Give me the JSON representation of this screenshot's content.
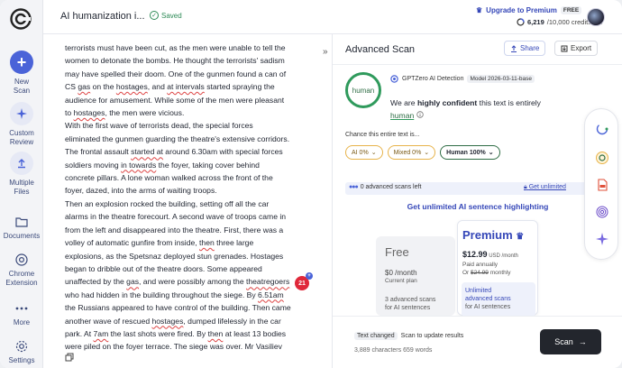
{
  "app": {
    "document_title": "AI humanization i...",
    "saved_label": "Saved",
    "upgrade_label": "Upgrade to Premium",
    "plan_badge": "FREE",
    "credits_used": "6,219",
    "credits_total": "/10,000 credits left"
  },
  "rail": {
    "new_scan": "New\nScan",
    "custom_review": "Custom\nReview",
    "multiple_files": "Multiple\nFiles",
    "documents": "Documents",
    "chrome_extension": "Chrome\nExtension",
    "more": "More",
    "settings": "Settings"
  },
  "document": {
    "text": "terrorists must have been cut, as the men were unable to tell the\nwomen to detonate the bombs. He thought the terrorists' sadism\nmay have spelled their doom. One of the gunmen found a can of\nCS gas on the hostages, and at intervals started spraying the\naudience for amusement. While some of the men were pleasant\nto hostages, the men were vicious.\nWith the first wave of terrorists dead, the special forces\neliminated the gunmen guarding the theatre's extensive corridors.\nThe frontal assault started at around 6.30am with special forces\nsoldiers moving in towards the foyer, taking cover behind\nconcrete pillars. A lone woman walked across the front of the\nfoyer, dazed, into the arms of waiting troops.\nThen an explosion rocked the building, setting off all the car\nalarms in the theatre forecourt. A second wave of troops came in\nfrom the left and disappeared into the theatre. First, there was a\nvolley of automatic gunfire from inside, then three large\nexplosions, as the Spetsnaz deployed stun grenades. Hostages\nbegan to dribble out of the theatre doors. Some appeared\nunaffected by the gas, and were possibly among the theatregoers\nwho had hidden in the building throughout the siege. By 6.51am\nthe Russians appeared to have control of the building. Then came\nanother wave of rescued hostages, dumped lifelessly in the car\npark. At 7am the last shots were fired. By then at least 13 bodies\nwere piled on the foyer terrace. The siege was over. Mr Vasiliev",
    "grammar_count": "21"
  },
  "panel": {
    "title": "Advanced Scan",
    "share_label": "Share",
    "export_label": "Export",
    "result_label": "human",
    "detector_name": "GPTZero AI Detection",
    "model_badge": "Model 2026-03-11-base",
    "verdict_prefix": "We are ",
    "verdict_confidence": "highly confident",
    "verdict_middle": " this text is entirely",
    "verdict_result": "human",
    "chance_label": "Chance this entire text is...",
    "pill_ai": "AI 0%",
    "pill_mixed": "Mixed 0%",
    "pill_human": "Human 100%",
    "scans_left": "0 advanced scans left",
    "get_unlimited": "Get unlimited",
    "upsell_title": "Get unlimited AI sentence highlighting",
    "free_plan": {
      "name": "Free",
      "price": "$0 /month",
      "sub": "Current plan",
      "feature": "3 advanced scans\nfor AI sentences"
    },
    "premium_plan": {
      "name": "Premium",
      "price": "$12.99",
      "price_unit": " USD /month",
      "billed": "Paid annually",
      "billed_alt_prefix": "Or ",
      "billed_alt_price": "$24.99",
      "billed_alt_suffix": " monthly",
      "feature_highlight": "Unlimited\nadvanced scans",
      "feature_rest": "for AI sentences"
    },
    "text_changed": "Text changed",
    "scan_to_update": "Scan to update results",
    "counts": "3,889 characters  659 words",
    "scan_button": "Scan"
  },
  "colors": {
    "brand": "#3547b8",
    "human_green": "#2f9a5c",
    "warning_amber": "#e7b34a",
    "grammar_red": "#e0283a"
  },
  "icons": [
    "gptzero-logo-icon",
    "plus-icon",
    "sparkle-icon",
    "upload-icon",
    "folder-icon",
    "chrome-icon",
    "more-icon",
    "gear-icon",
    "check-circle-icon",
    "crown-icon",
    "share-icon",
    "export-icon",
    "info-icon",
    "lock-icon",
    "arrow-right-icon",
    "copy-icon",
    "collapse-icon"
  ]
}
